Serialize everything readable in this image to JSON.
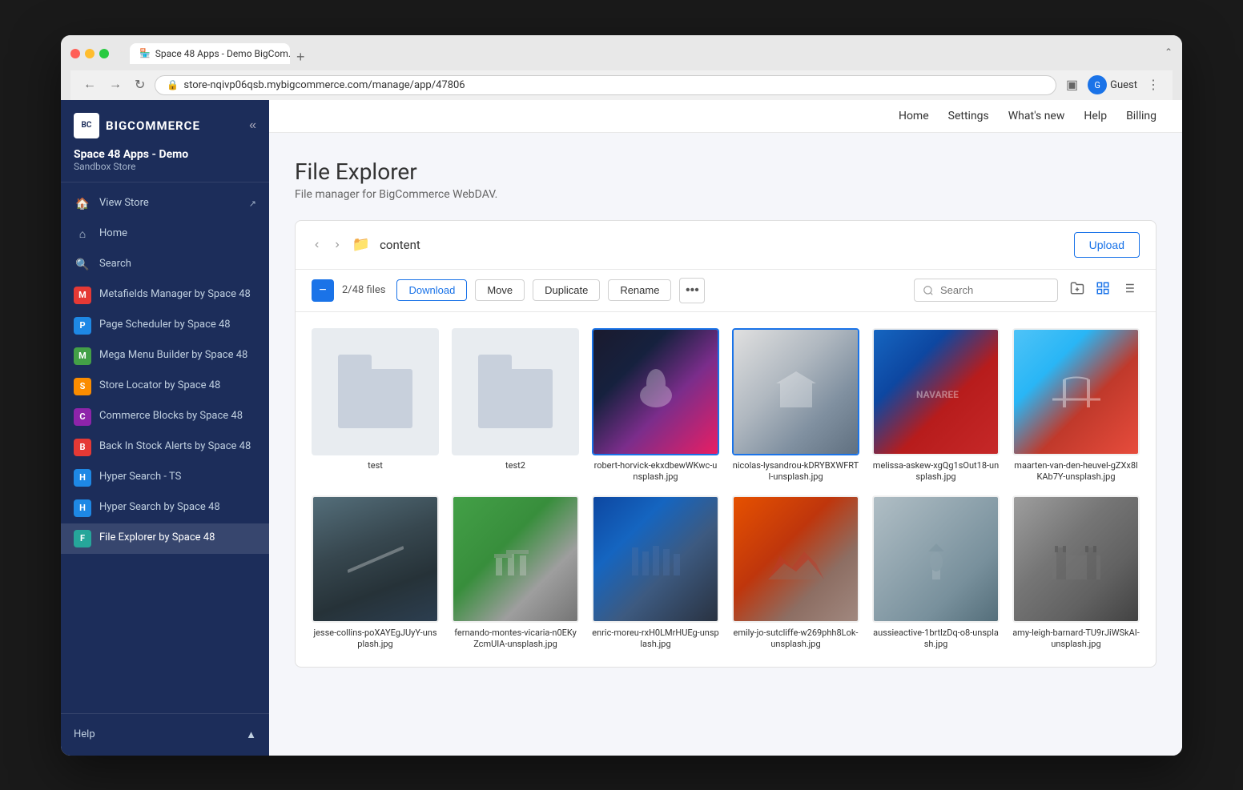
{
  "browser": {
    "tab_title": "Space 48 Apps - Demo BigCom...",
    "tab_icon": "🏪",
    "url": "store-nqivp06qsb.mybigcommerce.com/manage/app/47806",
    "new_tab_label": "+",
    "user_label": "Guest",
    "collapse_label": "⌃"
  },
  "sidebar": {
    "logo_text": "BIGCOMMERCE",
    "store_name": "Space 48 Apps - Demo",
    "store_type": "Sandbox Store",
    "nav_items": [
      {
        "id": "view-store",
        "label": "View Store",
        "icon": "🏠",
        "type": "nav"
      },
      {
        "id": "home",
        "label": "Home",
        "icon": "🏠",
        "type": "nav"
      },
      {
        "id": "search",
        "label": "Search",
        "icon": "🔍",
        "type": "nav"
      },
      {
        "id": "metafields",
        "label": "Metafields Manager by Space 48",
        "icon": "M",
        "color": "app-icon-metafields",
        "type": "app"
      },
      {
        "id": "page-scheduler",
        "label": "Page Scheduler by Space 48",
        "icon": "P",
        "color": "app-icon-scheduler",
        "type": "app"
      },
      {
        "id": "mega-menu",
        "label": "Mega Menu Builder by Space 48",
        "icon": "M",
        "color": "app-icon-mega",
        "type": "app"
      },
      {
        "id": "store-locator",
        "label": "Store Locator by Space 48",
        "icon": "S",
        "color": "app-icon-locator",
        "type": "app"
      },
      {
        "id": "commerce-blocks",
        "label": "Commerce Blocks by Space 48",
        "icon": "C",
        "color": "app-icon-blocks",
        "type": "app"
      },
      {
        "id": "back-in-stock",
        "label": "Back In Stock Alerts by Space 48",
        "icon": "B",
        "color": "app-icon-backstock",
        "type": "app"
      },
      {
        "id": "hyper-search-ts",
        "label": "Hyper Search - TS",
        "icon": "H",
        "color": "app-icon-hyperts",
        "type": "app"
      },
      {
        "id": "hyper-search-space",
        "label": "Hyper Search by Space 48",
        "icon": "H",
        "color": "app-icon-hyperspace",
        "type": "app"
      },
      {
        "id": "file-explorer",
        "label": "File Explorer by Space 48",
        "icon": "F",
        "color": "app-icon-fileexplorer",
        "type": "app",
        "active": true
      }
    ],
    "footer": {
      "help_label": "Help",
      "collapse_icon": "▲"
    }
  },
  "topbar": {
    "links": [
      "Home",
      "Settings",
      "What's new",
      "Help",
      "Billing"
    ]
  },
  "page": {
    "title": "File Explorer",
    "subtitle": "File manager for BigCommerce WebDAV."
  },
  "file_explorer": {
    "breadcrumb": "content",
    "upload_label": "Upload",
    "file_count": "2/48 files",
    "actions": {
      "download": "Download",
      "move": "Move",
      "duplicate": "Duplicate",
      "rename": "Rename",
      "more": "•••"
    },
    "search_placeholder": "Search",
    "folders": [
      {
        "id": "folder-test",
        "name": "test",
        "type": "folder"
      },
      {
        "id": "folder-test2",
        "name": "test2",
        "type": "folder"
      }
    ],
    "files": [
      {
        "id": "file-1",
        "name": "robert-horvick-ekxdbewWKwc-unsplash.jpg",
        "type": "image",
        "style": "img-epcot",
        "selected": true
      },
      {
        "id": "file-2",
        "name": "nicolas-lysandrou-kDRYBXWFRTI-unsplash.jpg",
        "type": "image",
        "style": "img-museum",
        "selected": true
      },
      {
        "id": "file-3",
        "name": "melissa-askew-xgQg1sOut18-unsplash.jpg",
        "type": "image",
        "style": "img-navaree",
        "selected": false
      },
      {
        "id": "file-4",
        "name": "maarten-van-den-heuvel-gZXx8lKAb7Y-unsplash.jpg",
        "type": "image",
        "style": "img-golden-gate",
        "selected": false
      },
      {
        "id": "file-5",
        "name": "jesse-collins-poXAYEgJUyY-unsplash.jpg",
        "type": "image",
        "style": "img-bridge",
        "selected": false
      },
      {
        "id": "file-6",
        "name": "fernando-montes-vicaria-n0EKyZcmUIA-unsplash.jpg",
        "type": "image",
        "style": "img-stonehenge",
        "selected": false
      },
      {
        "id": "file-7",
        "name": "enric-moreu-rxH0LMrHUEg-unsplash.jpg",
        "type": "image",
        "style": "img-causeway",
        "selected": false
      },
      {
        "id": "file-8",
        "name": "emily-jo-sutcliffe-w269phh8Lok-unsplash.jpg",
        "type": "image",
        "style": "img-canyon",
        "selected": false
      },
      {
        "id": "file-9",
        "name": "aussieactive-1brtlzDq-o8-unsplash.jpg",
        "type": "image",
        "style": "img-statue",
        "selected": false
      },
      {
        "id": "file-10",
        "name": "amy-leigh-barnard-TU9rJiWSkAI-unsplash.jpg",
        "type": "image",
        "style": "img-tower",
        "selected": false
      }
    ]
  }
}
